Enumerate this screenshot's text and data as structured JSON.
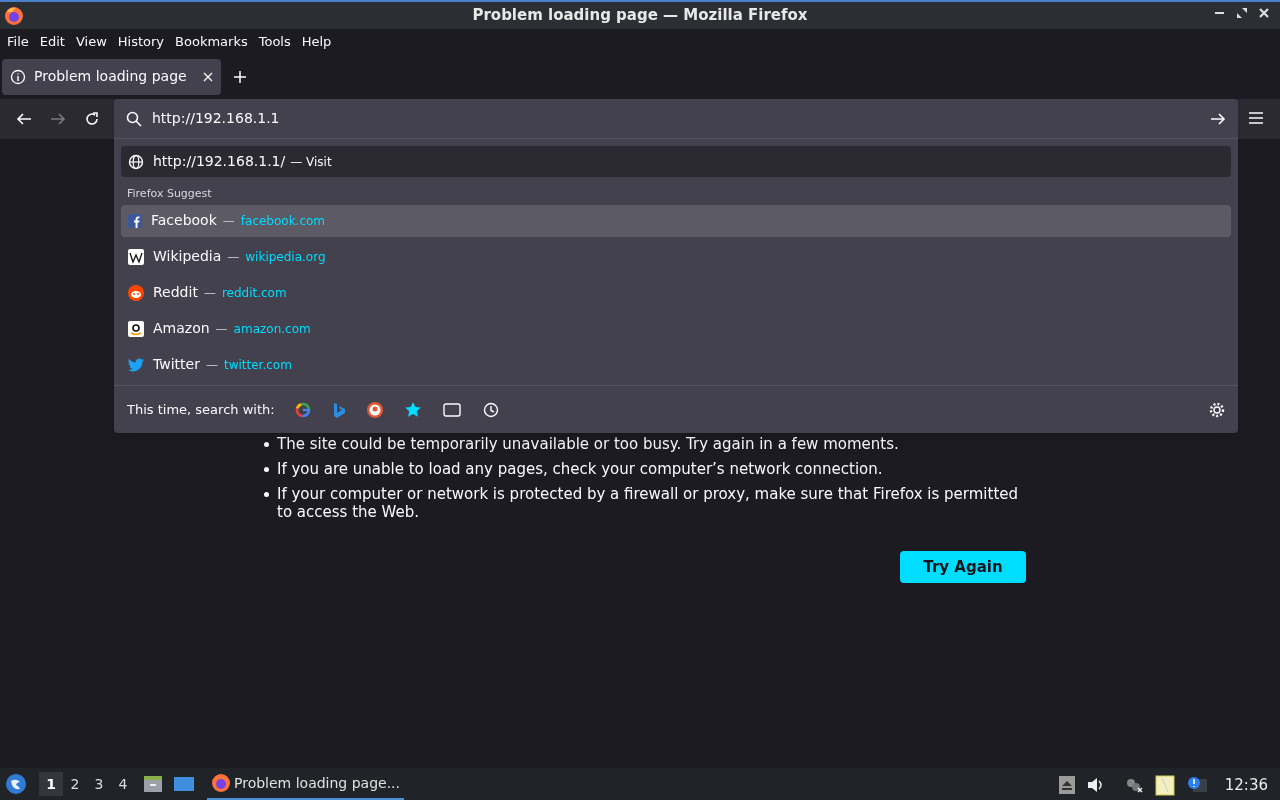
{
  "window": {
    "title": "Problem loading page — Mozilla Firefox"
  },
  "menu": [
    "File",
    "Edit",
    "View",
    "History",
    "Bookmarks",
    "Tools",
    "Help"
  ],
  "tabs": [
    {
      "label": "Problem loading page",
      "selected": true
    }
  ],
  "address_bar": {
    "value": "http://192.168.1.1"
  },
  "dropdown": {
    "visit": {
      "url": "http://192.168.1.1/",
      "action": "— Visit"
    },
    "section": "Firefox Suggest",
    "suggestions": [
      {
        "kind": "facebook",
        "title": "Facebook",
        "url": "facebook.com",
        "selected": true
      },
      {
        "kind": "wikipedia",
        "title": "Wikipedia",
        "url": "wikipedia.org",
        "selected": false
      },
      {
        "kind": "reddit",
        "title": "Reddit",
        "url": "reddit.com",
        "selected": false
      },
      {
        "kind": "amazon",
        "title": "Amazon",
        "url": "amazon.com",
        "selected": false
      },
      {
        "kind": "twitter",
        "title": "Twitter",
        "url": "twitter.com",
        "selected": false
      }
    ],
    "search_with": "This time, search with:",
    "separator": "—",
    "engines": [
      {
        "kind": "google"
      },
      {
        "kind": "bing"
      },
      {
        "kind": "duckduckgo"
      },
      {
        "kind": "bookmarks"
      },
      {
        "kind": "tabs"
      },
      {
        "kind": "history"
      }
    ]
  },
  "error_page": {
    "bullets": [
      "The site could be temporarily unavailable or too busy. Try again in a few moments.",
      "If you are unable to load any pages, check your computer’s network connection.",
      "If your computer or network is protected by a firewall or proxy, make sure that Firefox is permitted to access the Web."
    ],
    "button": "Try Again"
  },
  "taskbar": {
    "workspaces": [
      {
        "label": "1",
        "selected": true
      },
      {
        "label": "2",
        "selected": false
      },
      {
        "label": "3",
        "selected": false
      },
      {
        "label": "4",
        "selected": false
      }
    ],
    "task": "Problem loading page...",
    "clock": "12:36"
  }
}
